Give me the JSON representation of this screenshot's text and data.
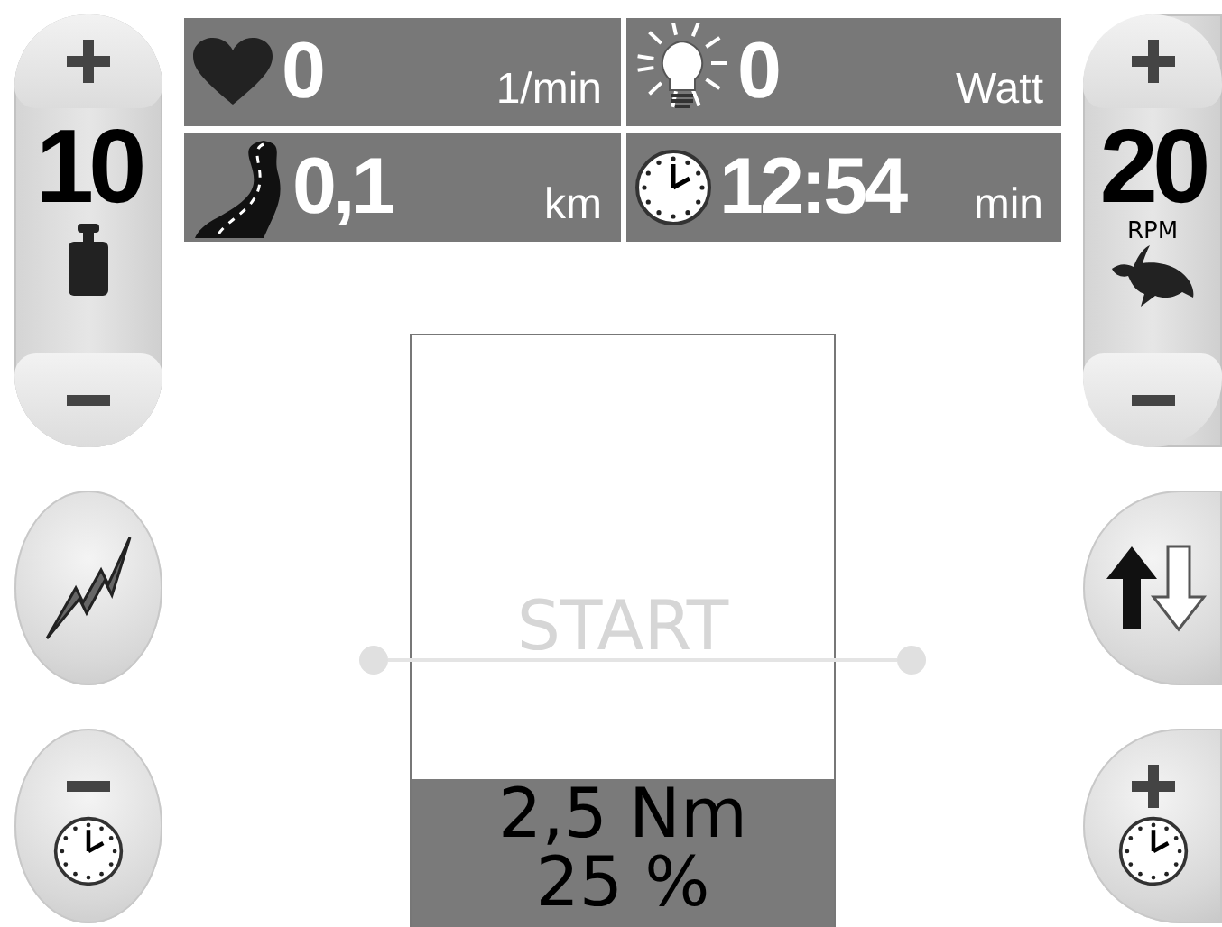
{
  "left_control": {
    "value": "10"
  },
  "stats": [
    {
      "kind": "heart",
      "value": "0",
      "unit": "1/min"
    },
    {
      "kind": "bulb",
      "value": "0",
      "unit": "Watt"
    },
    {
      "kind": "road",
      "value": "0,1",
      "unit": "km"
    },
    {
      "kind": "clock",
      "value": "12:54",
      "unit": "min"
    }
  ],
  "right_control": {
    "value": "20",
    "unit": "RPM"
  },
  "center": {
    "label": "START",
    "torque": "2,5 Nm",
    "percent": "25 %",
    "level": 0.25
  }
}
